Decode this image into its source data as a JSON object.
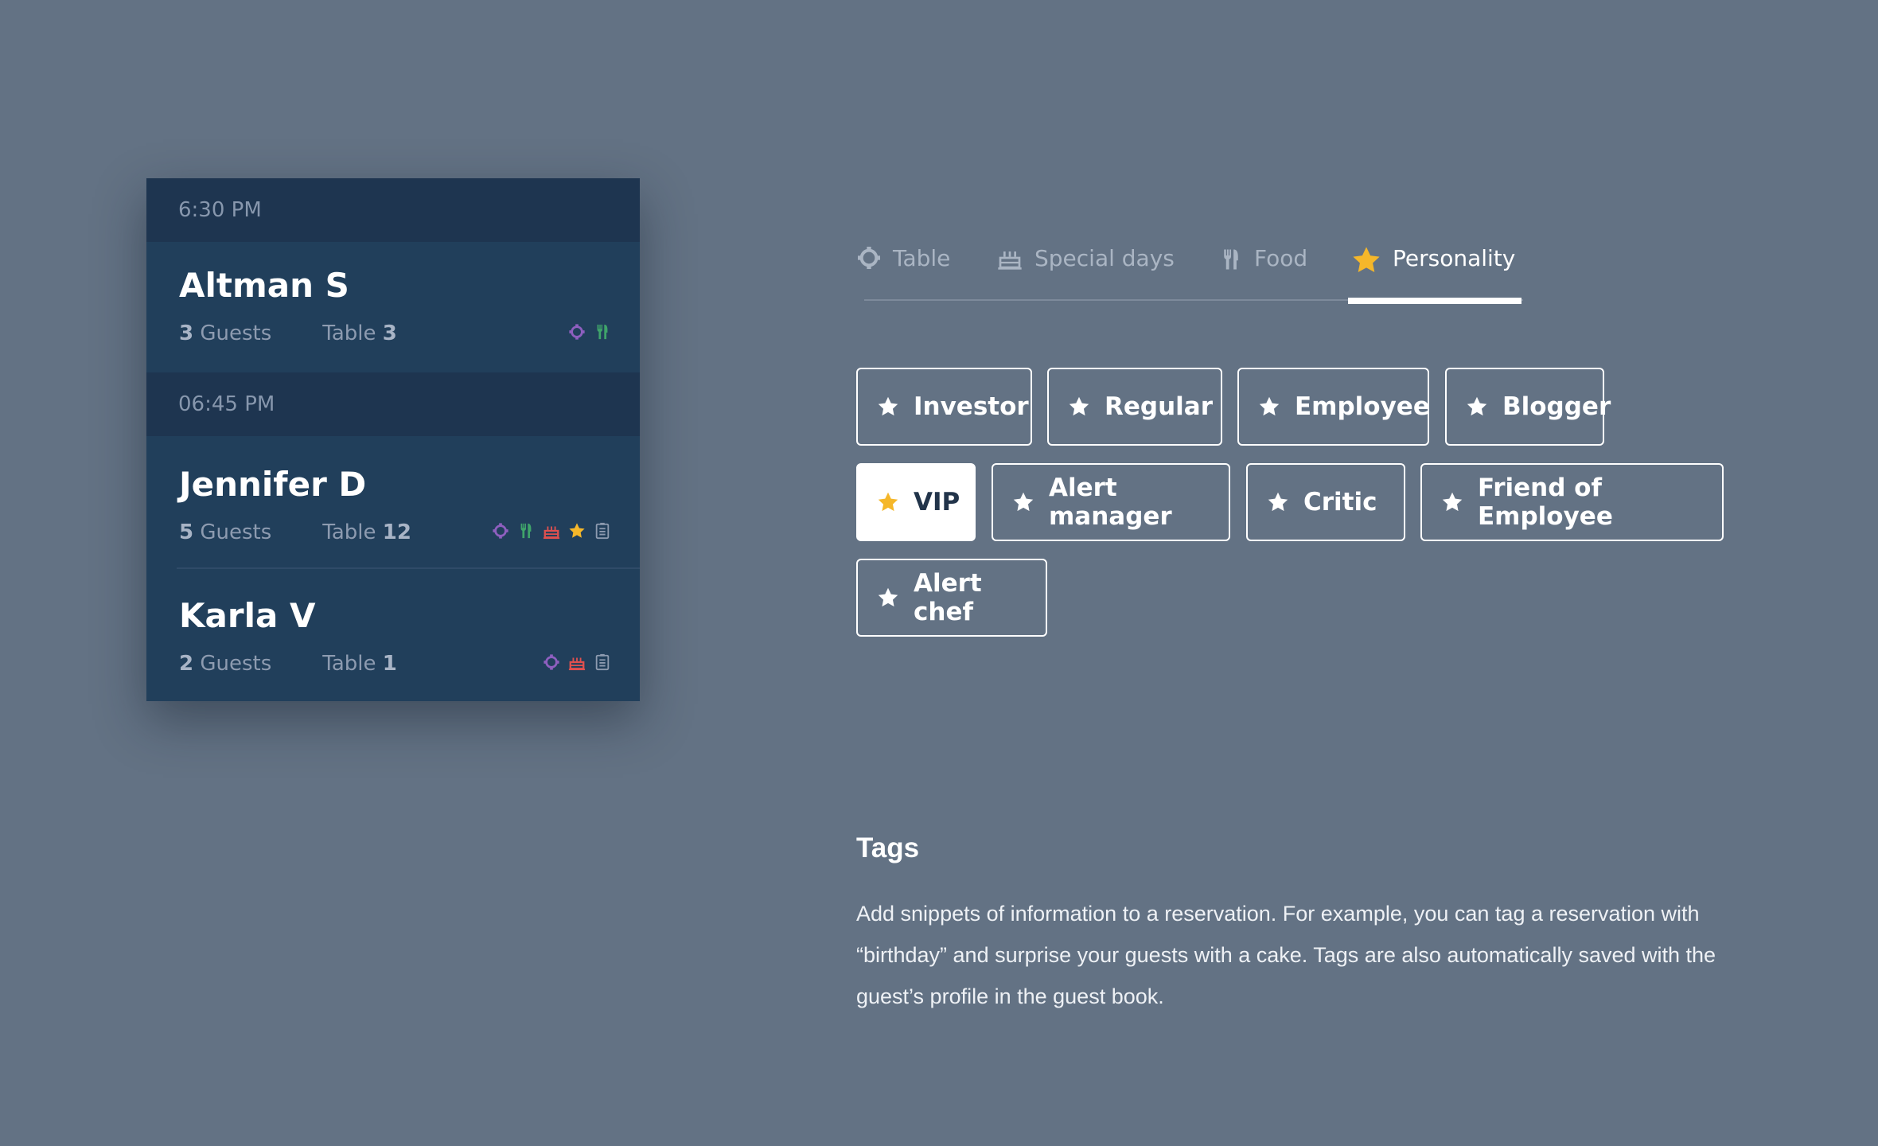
{
  "reservations": {
    "slots": [
      {
        "time": "6:30 PM",
        "guests": [
          {
            "name": "Altman S",
            "guests_count": "3",
            "guests_label": "Guests",
            "table_label": "Table",
            "table_number": "3",
            "icons": [
              "table-icon",
              "food-icon"
            ]
          }
        ]
      },
      {
        "time": "06:45 PM",
        "guests": [
          {
            "name": "Jennifer D",
            "guests_count": "5",
            "guests_label": "Guests",
            "table_label": "Table",
            "table_number": "12",
            "icons": [
              "table-icon",
              "food-icon",
              "cake-icon",
              "star-icon",
              "note-icon"
            ]
          },
          {
            "name": "Karla V",
            "guests_count": "2",
            "guests_label": "Guests",
            "table_label": "Table",
            "table_number": "1",
            "icons": [
              "table-icon",
              "cake-icon",
              "note-icon"
            ]
          }
        ]
      }
    ],
    "icon_colors": {
      "table": "#8e5fbf",
      "food": "#3fa46a",
      "cake": "#e0504f",
      "star": "#f5b72a",
      "note": "#8d9bb0"
    }
  },
  "tabs": [
    {
      "label": "Table",
      "icon": "table-icon",
      "active": false
    },
    {
      "label": "Special days",
      "icon": "cake-icon",
      "active": false
    },
    {
      "label": "Food",
      "icon": "food-icon",
      "active": false
    },
    {
      "label": "Personality",
      "icon": "star-icon",
      "active": true
    }
  ],
  "tags": [
    {
      "label": "Investor",
      "selected": false
    },
    {
      "label": "Regular",
      "selected": false
    },
    {
      "label": "Employee",
      "selected": false
    },
    {
      "label": "Blogger",
      "selected": false
    },
    {
      "label": "VIP",
      "selected": true
    },
    {
      "label": "Alert manager",
      "selected": false
    },
    {
      "label": "Critic",
      "selected": false
    },
    {
      "label": "Friend of Employee",
      "selected": false
    },
    {
      "label": "Alert chef",
      "selected": false
    }
  ],
  "description": {
    "title": "Tags",
    "body": "Add snippets of information to a reservation. For example, you can tag a reservation with “birthday” and surprise your guests with a cake. Tags are also automatically saved with the guest’s profile in the guest book."
  },
  "colors": {
    "background": "#637284",
    "accent_star": "#f5b72a"
  }
}
